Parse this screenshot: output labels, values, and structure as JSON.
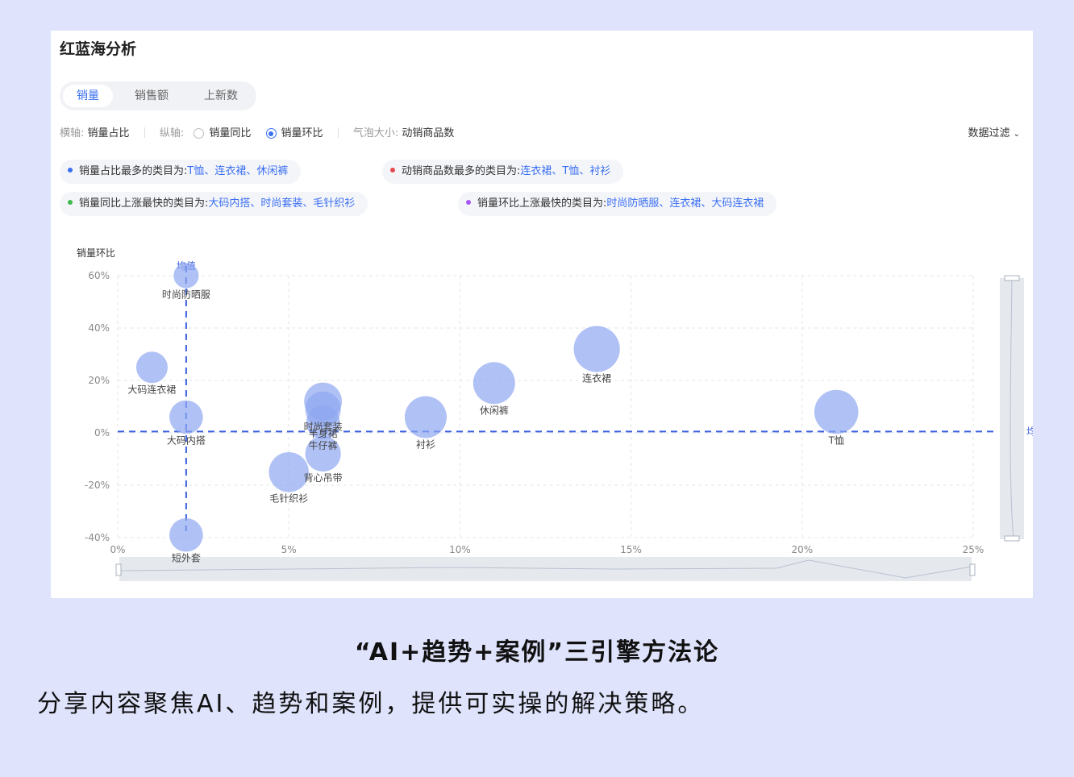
{
  "panel": {
    "title": "红蓝海分析",
    "tabs": [
      "销量",
      "销售额",
      "上新数"
    ],
    "active_tab": 0,
    "axis_row": {
      "x_label": "横轴:",
      "x_value": "销量占比",
      "y_label": "纵轴:",
      "y_option_1": "销量同比",
      "y_option_2": "销量环比",
      "y_selected": "销量环比",
      "size_label": "气泡大小:",
      "size_value": "动销商品数"
    },
    "filter_label": "数据过滤",
    "insights": [
      {
        "prefix": "销量占比最多的类目为:",
        "items": "T恤、连衣裙、休闲裤",
        "color": "#3a6ff2"
      },
      {
        "prefix": "动销商品数最多的类目为:",
        "items": "连衣裙、T恤、衬衫",
        "color": "#e5484d"
      },
      {
        "prefix": "销量同比上涨最快的类目为:",
        "items": "大码内搭、时尚套装、毛针织衫",
        "color": "#3fb950"
      },
      {
        "prefix": "销量环比上涨最快的类目为:",
        "items": "时尚防晒服、连衣裙、大码连衣裙",
        "color": "#a855f7"
      }
    ]
  },
  "chart_data": {
    "type": "scatter",
    "ylabel": "销量环比",
    "xlabel": "",
    "x_ticks": [
      "0%",
      "5%",
      "10%",
      "15%",
      "20%",
      "25%"
    ],
    "y_ticks": [
      "60%",
      "40%",
      "20%",
      "0%",
      "-20%",
      "-40%"
    ],
    "xlim": [
      0,
      25
    ],
    "ylim": [
      -40,
      60
    ],
    "grid": true,
    "bubble_color": "#8fa6f1",
    "avg_color": "#3a5fe0",
    "avg_x": 2,
    "avg_y": 0.5,
    "avg_label_x": "均值",
    "avg_label_y": "均值",
    "points": [
      {
        "name": "时尚防晒服",
        "x": 2.0,
        "y": 60,
        "size": 1.2
      },
      {
        "name": "大码连衣裙",
        "x": 1.0,
        "y": 25,
        "size": 1.5
      },
      {
        "name": "大码内搭",
        "x": 2.0,
        "y": 6,
        "size": 1.6
      },
      {
        "name": "时尚套装",
        "x": 6.0,
        "y": 12,
        "size": 1.8
      },
      {
        "name": "半身裙",
        "x": 6.0,
        "y": 9,
        "size": 1.7
      },
      {
        "name": "背心吊带",
        "x": 6.0,
        "y": -8,
        "size": 1.7
      },
      {
        "name": "牛仔裤",
        "x": 6.0,
        "y": 4,
        "size": 1.6
      },
      {
        "name": "毛针织衫",
        "x": 5.0,
        "y": -15,
        "size": 1.9
      },
      {
        "name": "衬衫",
        "x": 9.0,
        "y": 6,
        "size": 2.0
      },
      {
        "name": "休闲裤",
        "x": 11.0,
        "y": 19,
        "size": 2.0
      },
      {
        "name": "连衣裙",
        "x": 14.0,
        "y": 32,
        "size": 2.2
      },
      {
        "name": "T恤",
        "x": 21.0,
        "y": 8,
        "size": 2.1
      },
      {
        "name": "短外套",
        "x": 2.0,
        "y": -39,
        "size": 1.6
      }
    ]
  },
  "footer": {
    "headline": "“AI+趋势+案例”三引擎方法论",
    "subline": "分享内容聚焦AI、趋势和案例，提供可实操的解决策略。"
  }
}
